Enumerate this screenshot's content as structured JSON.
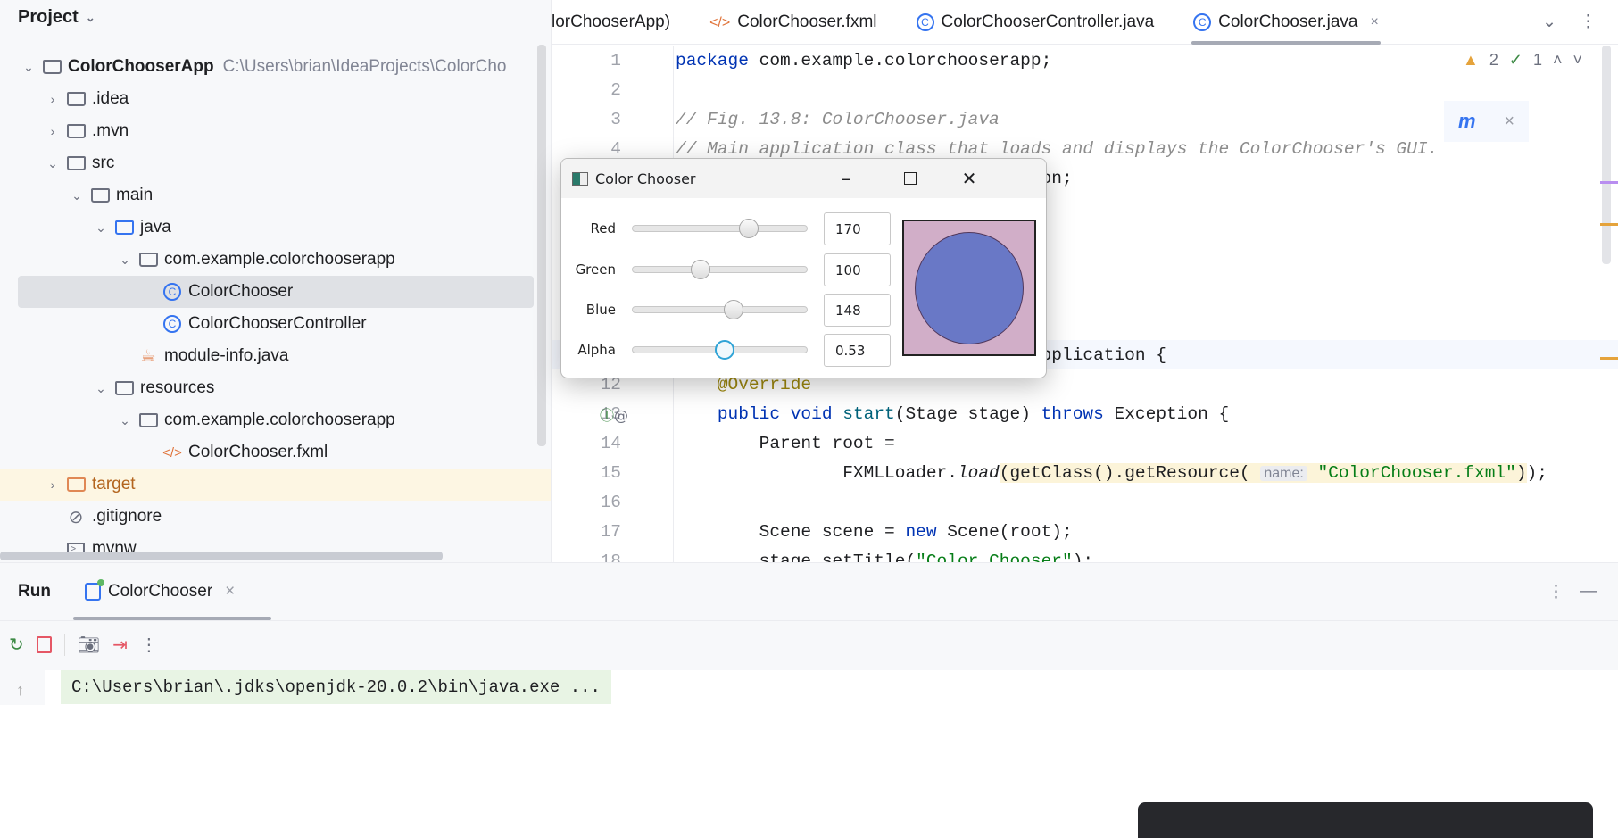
{
  "project": {
    "title": "Project",
    "tree": [
      {
        "label": "ColorChooserApp",
        "path": "C:\\Users\\brian\\IdeaProjects\\ColorCho",
        "icon": "module-folder-icon",
        "depth": 0,
        "expanded": true
      },
      {
        "label": ".idea",
        "icon": "folder-icon",
        "depth": 1,
        "expanded": false
      },
      {
        "label": ".mvn",
        "icon": "folder-icon",
        "depth": 1,
        "expanded": false
      },
      {
        "label": "src",
        "icon": "folder-icon",
        "depth": 1,
        "expanded": true
      },
      {
        "label": "main",
        "icon": "folder-icon",
        "depth": 2,
        "expanded": true
      },
      {
        "label": "java",
        "icon": "source-folder-icon",
        "depth": 3,
        "expanded": true
      },
      {
        "label": "com.example.colorchooserapp",
        "icon": "package-icon",
        "depth": 4,
        "expanded": true
      },
      {
        "label": "ColorChooser",
        "icon": "class-icon",
        "depth": 5,
        "selected": true
      },
      {
        "label": "ColorChooserController",
        "icon": "class-icon",
        "depth": 5
      },
      {
        "label": "module-info.java",
        "icon": "module-info-icon",
        "depth": 4
      },
      {
        "label": "resources",
        "icon": "resources-folder-icon",
        "depth": 3,
        "expanded": true
      },
      {
        "label": "com.example.colorchooserapp",
        "icon": "folder-icon",
        "depth": 4,
        "expanded": true
      },
      {
        "label": "ColorChooser.fxml",
        "icon": "fxml-icon",
        "depth": 5
      },
      {
        "label": "target",
        "icon": "excluded-folder-icon",
        "depth": 1,
        "expanded": false,
        "highlighted": true
      },
      {
        "label": ".gitignore",
        "icon": "ignore-icon",
        "depth": 1
      },
      {
        "label": "mvnw",
        "icon": "terminal-file-icon",
        "depth": 1
      }
    ]
  },
  "tabs": [
    {
      "label": "lorChooserApp)"
    },
    {
      "label": "ColorChooser.fxml",
      "icon": "fxml-icon"
    },
    {
      "label": "ColorChooserController.java",
      "icon": "class-icon"
    },
    {
      "label": "ColorChooser.java",
      "icon": "class-icon",
      "active": true,
      "close": "×"
    }
  ],
  "inspections": {
    "warnings": "2",
    "ok": "1"
  },
  "maven_reload": {
    "icon": "maven-reload-icon",
    "close": "×"
  },
  "editor": {
    "lines": [
      {
        "n": "1",
        "html": "<span class='kw'>package</span> com.example.colorchooserapp;"
      },
      {
        "n": "2",
        "html": ""
      },
      {
        "n": "3",
        "html": "<span class='cm'>// Fig. 13.8: ColorChooser.java</span>"
      },
      {
        "n": "4",
        "html": "<span class='cm'>// Main application class that loads and displays the ColorChooser's GUI.</span>"
      },
      {
        "n": "",
        "html": "                                  ion;"
      },
      {
        "n": "",
        "html": ""
      },
      {
        "n": "",
        "html": ""
      },
      {
        "n": "",
        "html": ""
      },
      {
        "n": "",
        "html": ""
      },
      {
        "n": "",
        "html": ""
      },
      {
        "n": "",
        "html": "                                  Application {",
        "hl": true
      },
      {
        "n": "12",
        "html": "    <span class='an'>@Override</span>"
      },
      {
        "n": "13",
        "html": "    <span class='kw'>public void</span> <span class='fn'>start</span>(Stage stage) <span class='kw'>throws</span> Exception {",
        "gutter": "override-icon"
      },
      {
        "n": "14",
        "html": "        Parent root ="
      },
      {
        "n": "15",
        "html": "                FXMLLoader.<span class='it'>load</span><span class='yel'>(getClass().getResource( <span class='hint'>name:</span> <span class='st'>\"ColorChooser.fxml\"</span>)</span>);"
      },
      {
        "n": "16",
        "html": ""
      },
      {
        "n": "17",
        "html": "        Scene scene = <span class='kw'>new</span> Scene(root);"
      },
      {
        "n": "18",
        "html": "        stage.setTitle(<span class='st'>\"Color Chooser\"</span>);"
      }
    ]
  },
  "run": {
    "title": "Run",
    "tab": "ColorChooser",
    "tab_close": "×",
    "command": "C:\\Users\\brian\\.jdks\\openjdk-20.0.2\\bin\\java.exe ..."
  },
  "dialog": {
    "title": "Color Chooser",
    "rows": [
      {
        "label": "Red",
        "value": "170",
        "fraction": 0.667
      },
      {
        "label": "Green",
        "value": "100",
        "fraction": 0.392
      },
      {
        "label": "Blue",
        "value": "148",
        "fraction": 0.58
      },
      {
        "label": "Alpha",
        "value": "0.53",
        "fraction": 0.53,
        "focused": true
      }
    ],
    "preview_background": "#d1aec8",
    "preview_circle": "#6978c6"
  }
}
